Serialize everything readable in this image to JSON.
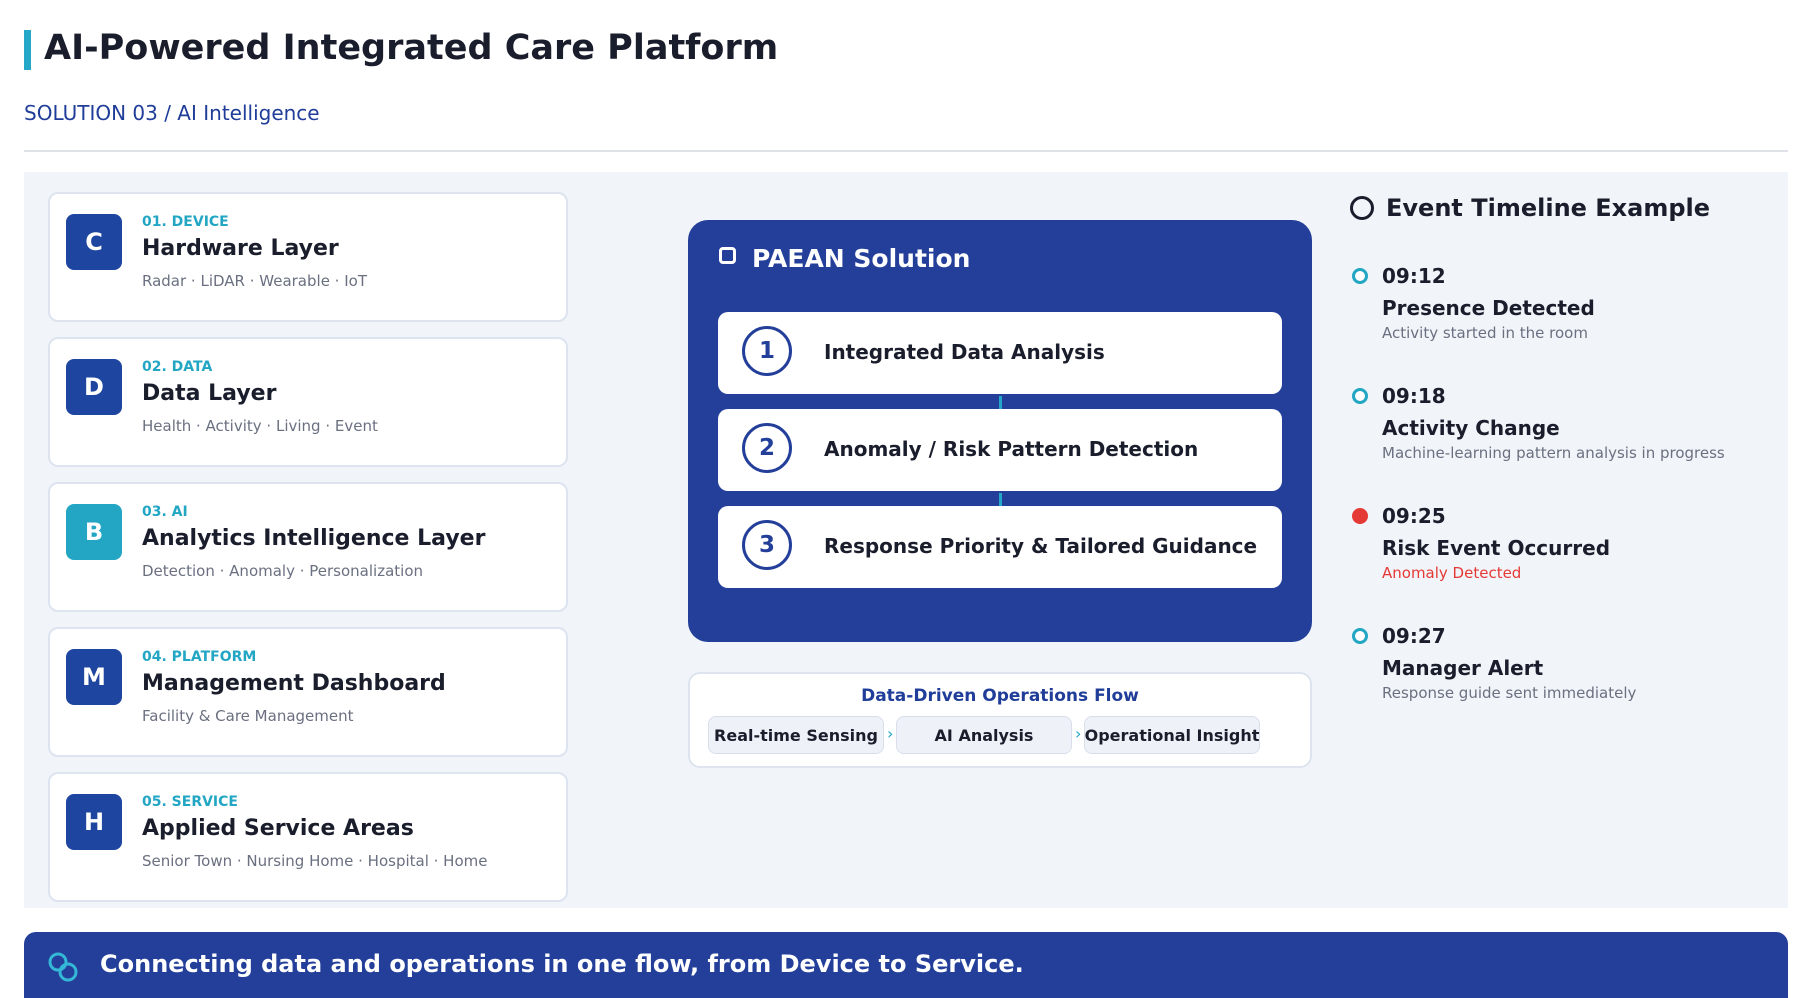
{
  "header": {
    "title": "AI-Powered Integrated Care Platform",
    "subtitle": "SOLUTION 03 / AI Intelligence"
  },
  "layers": [
    {
      "badge": "C",
      "tag": "01. DEVICE",
      "name": "Hardware Layer",
      "desc": "Radar · LiDAR · Wearable · IoT"
    },
    {
      "badge": "D",
      "tag": "02. DATA",
      "name": "Data Layer",
      "desc": "Health · Activity · Living · Event"
    },
    {
      "badge": "B",
      "tag": "03. AI",
      "name": "Analytics Intelligence Layer",
      "desc": "Detection · Anomaly · Personalization"
    },
    {
      "badge": "M",
      "tag": "04. PLATFORM",
      "name": "Management Dashboard",
      "desc": "Facility & Care Management"
    },
    {
      "badge": "H",
      "tag": "05. SERVICE",
      "name": "Applied Service Areas",
      "desc": "Senior Town · Nursing Home · Hospital · Home"
    }
  ],
  "paean": {
    "title": "PAEAN Solution",
    "steps": [
      {
        "num": "1",
        "label": "Integrated Data Analysis"
      },
      {
        "num": "2",
        "label": "Anomaly / Risk Pattern Detection"
      },
      {
        "num": "3",
        "label": "Response Priority & Tailored Guidance"
      }
    ]
  },
  "flow": {
    "title": "Data-Driven Operations Flow",
    "steps": [
      "Real-time Sensing",
      "AI Analysis",
      "Operational Insight"
    ],
    "arrow": "›"
  },
  "timeline": {
    "title": "Event Timeline Example",
    "events": [
      {
        "time": "09:12",
        "name": "Presence Detected",
        "desc": "Activity started in the room"
      },
      {
        "time": "09:18",
        "name": "Activity Change",
        "desc": "Machine-learning pattern analysis in progress"
      },
      {
        "time": "09:25",
        "name": "Risk Event Occurred",
        "desc": "Anomaly Detected"
      },
      {
        "time": "09:27",
        "name": "Manager Alert",
        "desc": "Response guide sent immediately"
      }
    ]
  },
  "footer": {
    "text": "Connecting data and operations in one flow, from Device to Service."
  },
  "colors": {
    "navy": "#233f9a",
    "teal": "#22a6c4",
    "alert": "#e53935"
  }
}
